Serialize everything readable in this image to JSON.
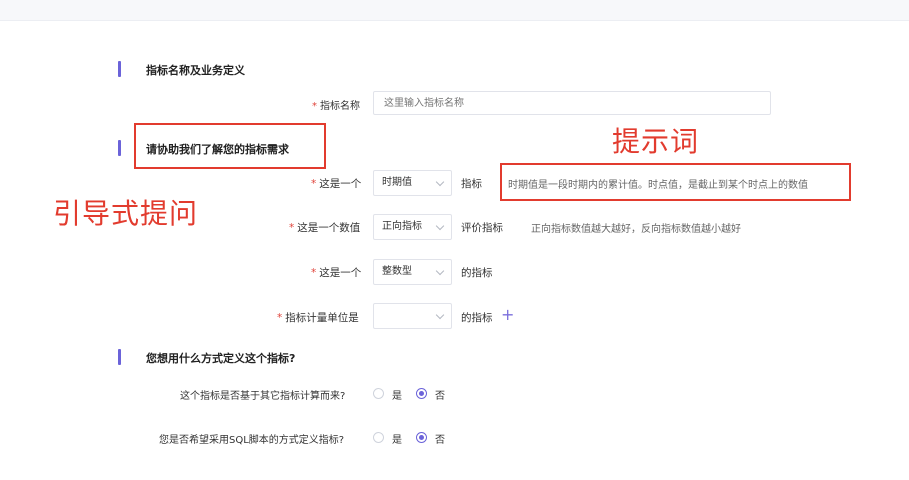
{
  "sections": {
    "basic": "指标名称及业务定义",
    "guide": "请协助我们了解您的指标需求",
    "method": "您想用什么方式定义这个指标?"
  },
  "name_field": {
    "label": "指标名称",
    "placeholder": "这里输入指标名称"
  },
  "row1": {
    "label": "这是一个",
    "select": "时期值",
    "suffix": "指标",
    "hint": "时期值是一段时期内的累计值。时点值，是截止到某个时点上的数值"
  },
  "row2": {
    "label": "这是一个数值",
    "select": "正向指标",
    "suffix": "评价指标",
    "hint": "正向指标数值越大越好，反向指标数值越小越好"
  },
  "row3": {
    "label": "这是一个",
    "select": "整数型",
    "suffix": "的指标"
  },
  "row4": {
    "label": "指标计量单位是",
    "select": "",
    "suffix": "的指标",
    "add_icon": "plus-icon"
  },
  "q1": {
    "label": "这个指标是否基于其它指标计算而来?",
    "yes": "是",
    "no": "否",
    "selected": "否"
  },
  "q2": {
    "label": "您是否希望采用SQL脚本的方式定义指标?",
    "yes": "是",
    "no": "否",
    "selected": "否"
  },
  "annotations": {
    "prompt_word": "提示词",
    "guided_question": "引导式提问"
  },
  "colors": {
    "accent": "#6b63d9",
    "annotation": "#e23b2e",
    "required": "#e0433a"
  }
}
